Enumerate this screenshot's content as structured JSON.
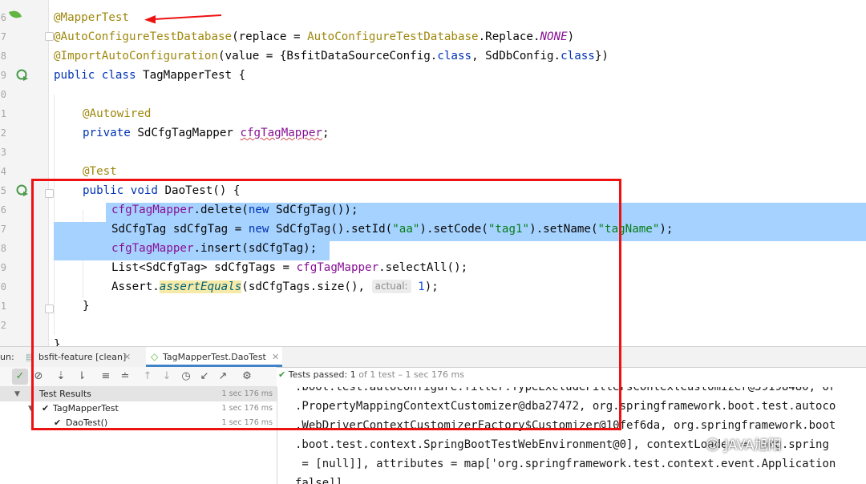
{
  "editor": {
    "line_numbers": [
      "6",
      "7",
      "8",
      "9",
      "0",
      "1",
      "2",
      "3",
      "4",
      "5",
      "6",
      "7",
      "8",
      "9",
      "0",
      "1",
      "2"
    ],
    "code": {
      "l1": "@MapperTest",
      "l2a": "@AutoConfigureTestDatabase",
      "l2b": "(replace = ",
      "l2c": "AutoConfigureTestDatabase",
      "l2d": ".Replace.",
      "l2e": "NONE",
      "l2f": ")",
      "l3a": "@ImportAutoConfiguration",
      "l3b": "(value = {BsfitDataSourceConfig.",
      "l3c": "class",
      "l3d": ", SdDbConfig.",
      "l3e": "class",
      "l3f": "})",
      "l4a": "public class ",
      "l4b": "TagMapperTest {",
      "l6": "@Autowired",
      "l7a": "private ",
      "l7b": "SdCfgTagMapper ",
      "l7c": "cfgTagMapper",
      "l7d": ";",
      "l9": "@Test",
      "l10a": "public void ",
      "l10b": "DaoTest() {",
      "l11a": "cfgTagMapper",
      "l11b": ".delete(",
      "l11c": "new ",
      "l11d": "SdCfgTag());",
      "l12a": "SdCfgTag sdCfgTag = ",
      "l12b": "new ",
      "l12c": "SdCfgTag().setId(",
      "l12d": "\"aa\"",
      "l12e": ").setCode(",
      "l12f": "\"tag1\"",
      "l12g": ").setName(",
      "l12h": "\"tagName\"",
      "l12i": ");",
      "l13a": "cfgTagMapper",
      "l13b": ".insert(sdCfgTag);",
      "l14a": "List<SdCfgTag> sdCfgTags = ",
      "l14b": "cfgTagMapper",
      "l14c": ".selectAll();",
      "l15a": "Assert.",
      "l15b": "assertEquals",
      "l15c": "(sdCfgTags.size(), ",
      "l15hint": "actual:",
      "l15d": "1",
      "l15e": ");",
      "l16": "}",
      "l18": "}"
    }
  },
  "run_panel": {
    "label": "un:",
    "tab_config": "bsfit-feature [clean]",
    "tab_test": "TagMapperTest.DaoTest",
    "status_main": "Tests passed: 1",
    "status_detail": " of 1 test – 1 sec 176 ms",
    "tree": [
      {
        "label": "Test Results",
        "time": "1 sec 176 ms"
      },
      {
        "label": "TagMapperTest",
        "time": "1 sec 176 ms"
      },
      {
        "label": "DaoTest()",
        "time": "1 sec 176 ms"
      }
    ],
    "console_lines": [
      ".boot.test.autoconfigure.filter.TypeExcludeFiltersContextCustomizer@39198480, or",
      ".PropertyMappingContextCustomizer@dba27472, org.springframework.boot.test.autoco",
      ".WebDriverContextCustomizerFactory$Customizer@10fef6da, org.springframework.boot",
      ".boot.test.context.SpringBootTestWebEnvironment@0], contextLoader = 'org.spring",
      " = [null]], attributes = map['org.springframework.test.context.event.Application",
      "false]]"
    ]
  },
  "watermark": "JAVA旭阳",
  "colors": {
    "highlight": "#a6d2ff",
    "annotation": "#9e880d",
    "keyword": "#0033b3",
    "field": "#871094",
    "string": "#067d17",
    "red_markup": "#ee1111",
    "pass_green": "#3b9a3b"
  }
}
